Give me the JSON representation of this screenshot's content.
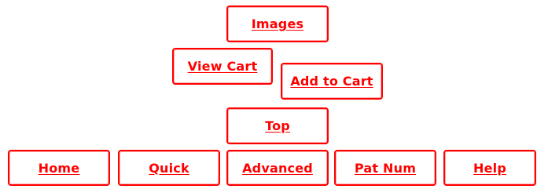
{
  "nav": {
    "images": "Images",
    "view_cart": "View Cart",
    "add_to_cart": "Add to Cart",
    "top": "Top",
    "home": "Home",
    "quick": "Quick",
    "advanced": "Advanced",
    "pat_num": "Pat Num",
    "help": "Help"
  },
  "colors": {
    "accent": "#ff0000",
    "background": "#ffffff"
  }
}
